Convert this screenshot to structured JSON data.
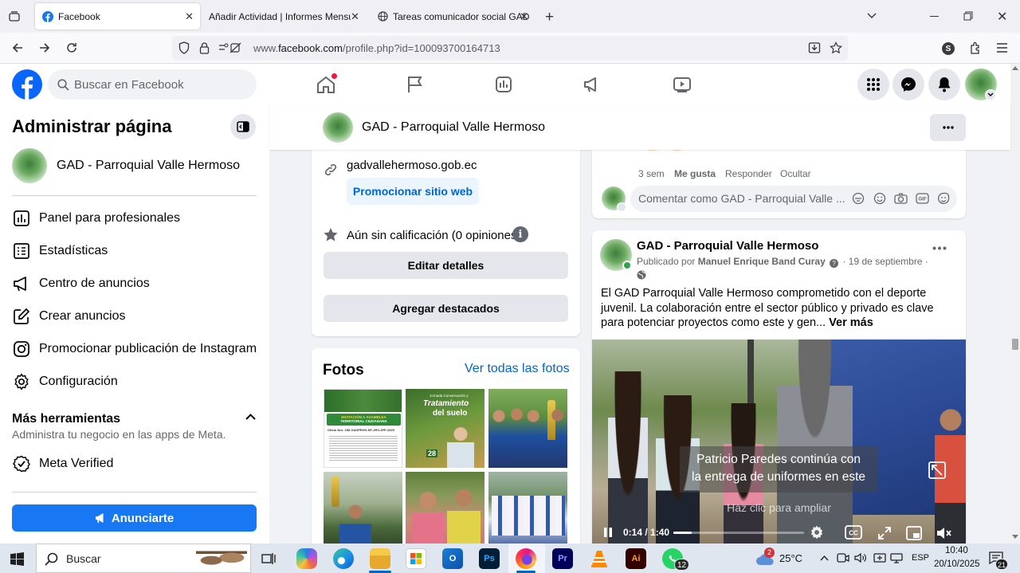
{
  "browser": {
    "tabs": [
      {
        "title": "Facebook",
        "active": true
      },
      {
        "title": "Añadir Actividad | Informes Mensua",
        "active": false
      },
      {
        "title": "Tareas comunicador social GAD",
        "active": false
      }
    ],
    "url_prefix": "www.",
    "url_domain": "facebook.com",
    "url_path": "/profile.php?id=100093700164713"
  },
  "fb": {
    "search_placeholder": "Buscar en Facebook"
  },
  "sidebar": {
    "title": "Administrar página",
    "page_name": "GAD - Parroquial Valle Hermoso",
    "items": [
      {
        "label": "Panel para profesionales",
        "icon": "dashboard-icon"
      },
      {
        "label": "Estadísticas",
        "icon": "stats-icon"
      },
      {
        "label": "Centro de anuncios",
        "icon": "megaphone-icon"
      },
      {
        "label": "Crear anuncios",
        "icon": "edit-icon"
      },
      {
        "label": "Promocionar publicación de Instagram",
        "icon": "instagram-icon"
      },
      {
        "label": "Configuración",
        "icon": "gear-icon"
      }
    ],
    "tools_title": "Más herramientas",
    "tools_subtitle": "Administra tu negocio en las apps de Meta.",
    "meta_verified": "Meta Verified",
    "advertise_button": "Anunciarte"
  },
  "page_header": {
    "name": "GAD - Parroquial Valle Hermoso"
  },
  "intro": {
    "website": "gadvallehermoso.gob.ec",
    "promote_site": "Promocionar sitio web",
    "rating": "Aún sin calificación (0 opiniones)",
    "edit_details": "Editar detalles",
    "add_featured": "Agregar destacados"
  },
  "photos": {
    "title": "Fotos",
    "see_all": "Ver todas las fotos",
    "tile1": {
      "line1": "INVITACIÓN A ASAMBLEA",
      "line2": "TERRITORIAL CIUDADANA",
      "line3": "Oficio Nro. 258 GADPRVH-SP-JRV-JPP-2025"
    },
    "tile2": {
      "line1": "Jornada Conservación y",
      "line2": "Tratamiento",
      "line3": "del suelo",
      "date": "28"
    }
  },
  "comment_box": {
    "time": "3 sem",
    "like": "Me gusta",
    "reply": "Responder",
    "hide": "Ocultar",
    "placeholder": "Comentar como GAD - Parroquial Valle ..."
  },
  "post": {
    "author": "GAD - Parroquial Valle Hermoso",
    "published_by_prefix": "Publicado por",
    "publisher": "Manuel Enrique Band Curay",
    "date": "· 19 de septiembre ·",
    "text": "El GAD Parroquial Valle Hermoso comprometido con el deporte juvenil. La colaboración entre el sector público y privado es clave para potenciar proyectos como este y gen...",
    "see_more": "Ver más",
    "video": {
      "caption_line1": "Patricio Paredes continúa con",
      "caption_line2": "la entrega de uniformes en este",
      "tap_hint": "Haz clic para ampliar",
      "time": "0:14 / 1:40",
      "progress": 0.14
    }
  },
  "taskbar": {
    "search": "Buscar",
    "weather": "25°C",
    "weather_badge": "2",
    "lang": "ESP",
    "time": "10:40",
    "date": "20/10/2025",
    "notif_count": "21",
    "whatsapp_badge": "12"
  }
}
